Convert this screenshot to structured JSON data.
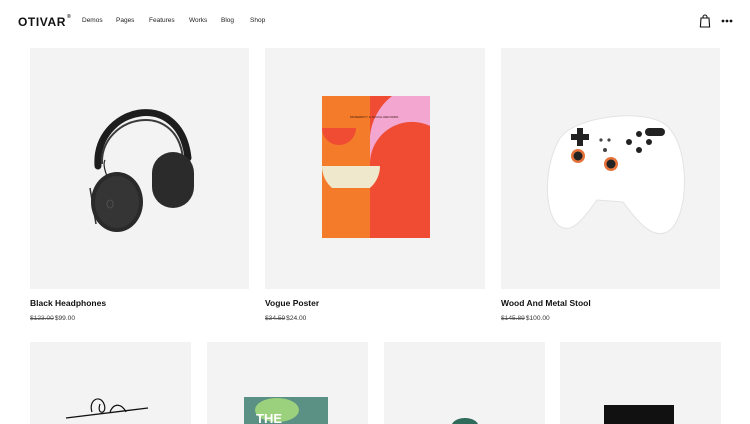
{
  "brand": {
    "name": "OTIVAR",
    "mark": "®"
  },
  "nav": {
    "items": [
      {
        "label": "Demos"
      },
      {
        "label": "Pages"
      },
      {
        "label": "Features"
      },
      {
        "label": "Works"
      },
      {
        "label": "Blog"
      },
      {
        "label": "Shop"
      }
    ]
  },
  "header_icons": {
    "bag": "shopping-bag-icon",
    "more": "more-dots-icon"
  },
  "products": [
    {
      "name": "Black Headphones",
      "old_price": "$123.00",
      "price": "$99.00",
      "image": "headphones-image"
    },
    {
      "name": "Vogue Poster",
      "old_price": "$34.59",
      "price": "$24.00",
      "image": "poster-image",
      "poster_text": "MODERNITY & SOCIAL REFORMS"
    },
    {
      "name": "Wood And Metal Stool",
      "old_price": "$145.89",
      "price": "$100.00",
      "image": "game-controller-image"
    }
  ],
  "second_row": [
    {
      "image": "shopping-bag-illustration"
    },
    {
      "image": "book-cover-image",
      "cover_text": "THE"
    },
    {
      "image": "teapot-image"
    },
    {
      "image": "black-box-image"
    }
  ],
  "colors": {
    "background": "#ffffff",
    "card": "#f3f3f3",
    "text": "#111111",
    "poster_orange": "#f47b2a",
    "poster_red": "#ef4c33",
    "poster_pink": "#f3a6cf",
    "poster_cream": "#efe8cc",
    "controller_orange": "#e5733a"
  }
}
